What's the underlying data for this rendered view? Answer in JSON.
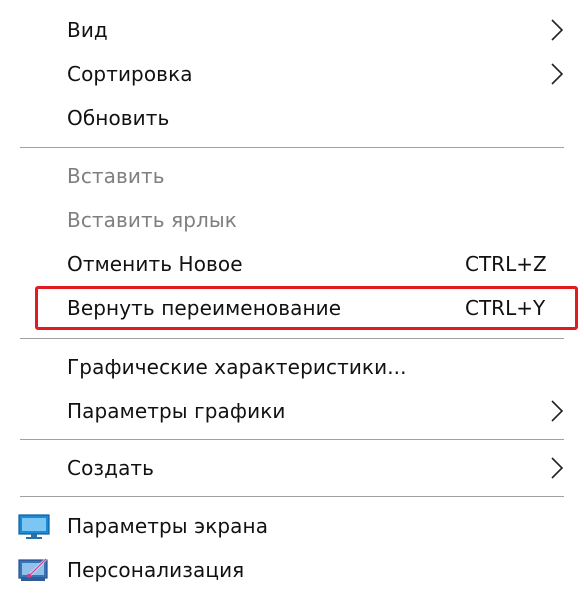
{
  "menu": {
    "items": [
      {
        "label": "Вид",
        "submenu": true
      },
      {
        "label": "Сортировка",
        "submenu": true
      },
      {
        "label": "Обновить"
      },
      {
        "label": "Вставить",
        "disabled": true
      },
      {
        "label": "Вставить ярлык",
        "disabled": true
      },
      {
        "label": "Отменить Новое",
        "shortcut": "CTRL+Z"
      },
      {
        "label": "Вернуть переименование",
        "shortcut": "CTRL+Y",
        "highlighted": true
      },
      {
        "label": "Графические характеристики..."
      },
      {
        "label": "Параметры графики",
        "submenu": true
      },
      {
        "label": "Создать",
        "submenu": true
      },
      {
        "label": "Параметры экрана",
        "icon": "display-settings-icon"
      },
      {
        "label": "Персонализация",
        "icon": "personalization-icon"
      }
    ]
  },
  "colors": {
    "highlight_border": "#e11b22",
    "disabled_text": "#7f7f7f",
    "separator": "#a0a0a0"
  }
}
